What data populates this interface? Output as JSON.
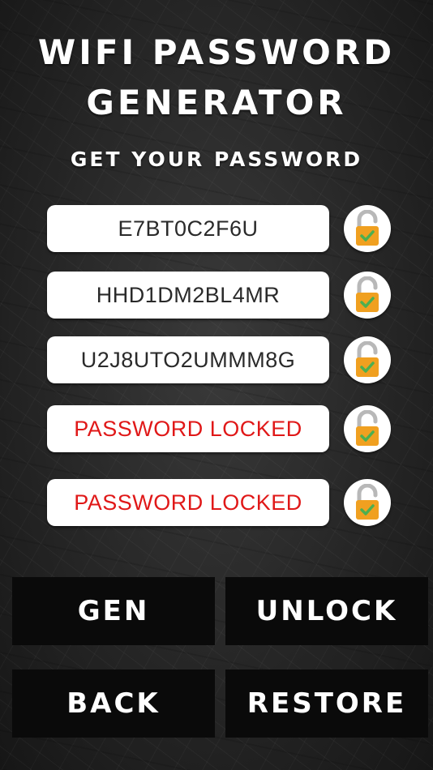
{
  "header": {
    "title_line1": "WIFI PASSWORD",
    "title_line2": "GENERATOR",
    "subtitle": "GET YOUR PASSWORD"
  },
  "passwords": [
    {
      "value": "E7BT0C2F6U",
      "locked": false
    },
    {
      "value": "HHD1DM2BL4MR",
      "locked": false
    },
    {
      "value": "U2J8UTO2UMMM8G",
      "locked": false
    },
    {
      "value": "PASSWORD LOCKED",
      "locked": true
    },
    {
      "value": "PASSWORD LOCKED",
      "locked": true
    }
  ],
  "buttons": {
    "gen": "GEN",
    "unlock": "UNLOCK",
    "back": "BACK",
    "restore": "RESTORE"
  },
  "colors": {
    "locked_text": "#e01818",
    "normal_text": "#2a2a2a",
    "lock_icon": "#f0a020",
    "check": "#4caf50"
  },
  "icons": {
    "row_icon": "open-padlock-icon"
  }
}
